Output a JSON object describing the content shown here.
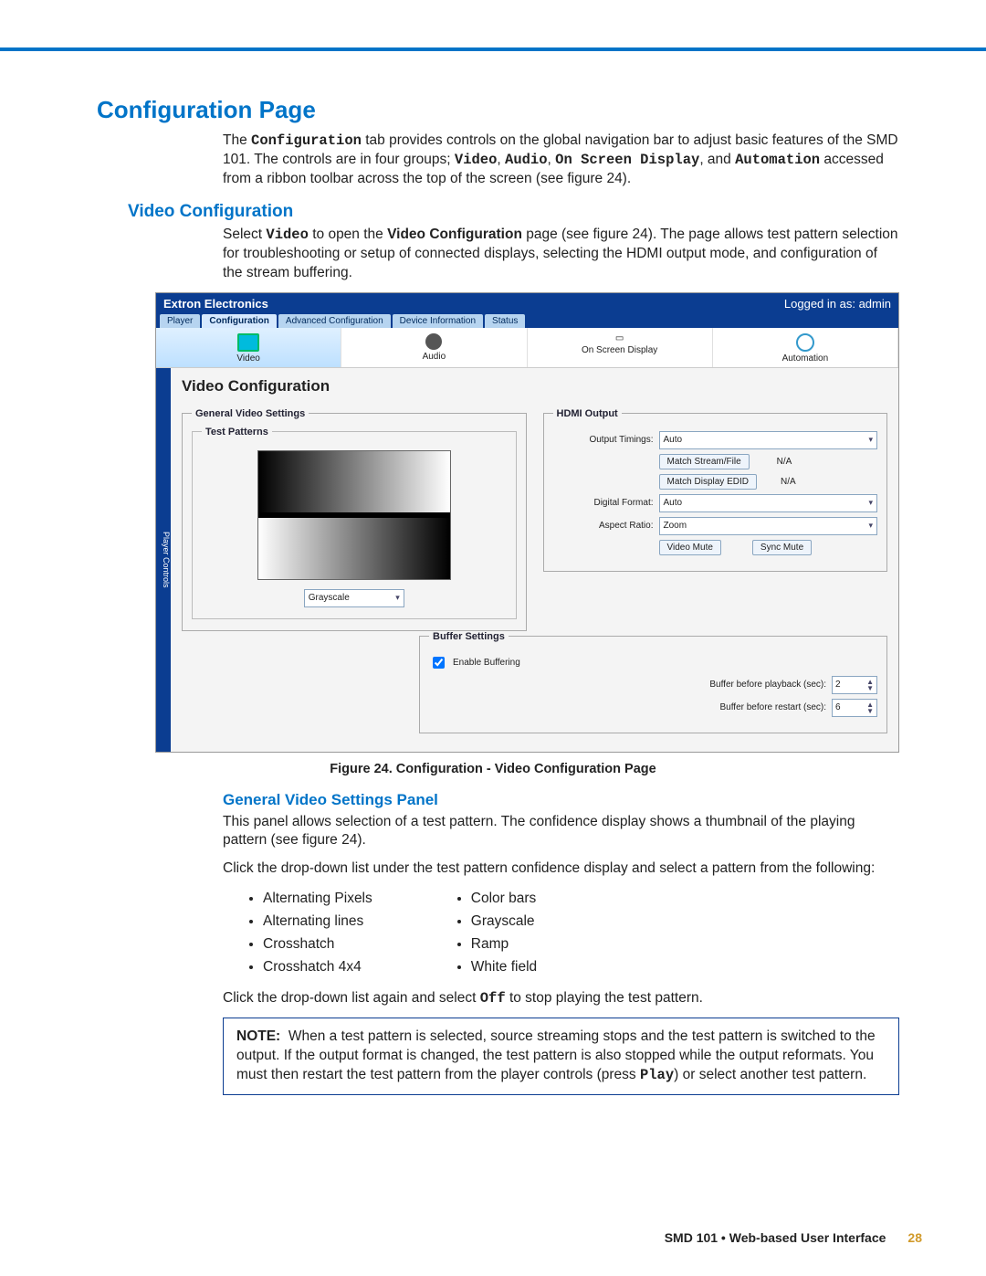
{
  "headings": {
    "h1": "Configuration Page",
    "h2": "Video Configuration",
    "h3": "General Video Settings Panel"
  },
  "intro": {
    "pre1": "The ",
    "m1": "Configuration",
    "mid1": " tab provides controls on the global navigation bar to adjust basic features of the SMD 101. The controls are in four groups; ",
    "m2": "Video",
    "c1": ", ",
    "m3": "Audio",
    "c2": ", ",
    "m4": "On Screen Display",
    "mid2": ", and ",
    "m5": "Automation",
    "post": " accessed from a ribbon toolbar across the top of the screen (see figure 24)."
  },
  "videointro": {
    "pre": "Select ",
    "m1": "Video",
    "mid1": " to open the ",
    "b1": "Video Configuration",
    "post": " page (see figure 24). The page allows test pattern selection for troubleshooting or setup of connected displays, selecting the HDMI output mode, and configuration of the stream buffering."
  },
  "screenshot": {
    "brand": "Extron Electronics",
    "login": "Logged in as: admin",
    "tabs": [
      "Player",
      "Configuration",
      "Advanced Configuration",
      "Device Information",
      "Status"
    ],
    "active_tab": 1,
    "ribbon": [
      "Video",
      "Audio",
      "On Screen Display",
      "Automation"
    ],
    "active_ribbon": 0,
    "sidebar": "Player Controls",
    "main_title": "Video Configuration",
    "general_legend": "General Video Settings",
    "test_legend": "Test Patterns",
    "pattern_value": "Grayscale",
    "hdmi_legend": "HDMI Output",
    "hdmi": {
      "timings_lbl": "Output Timings:",
      "timings_val": "Auto",
      "match_stream_btn": "Match Stream/File",
      "match_stream_val": "N/A",
      "match_edid_btn": "Match Display EDID",
      "match_edid_val": "N/A",
      "digital_lbl": "Digital Format:",
      "digital_val": "Auto",
      "aspect_lbl": "Aspect Ratio:",
      "aspect_val": "Zoom",
      "videomute_btn": "Video Mute",
      "syncmute_btn": "Sync Mute"
    },
    "buffer_legend": "Buffer Settings",
    "buffer": {
      "enable_lbl": "Enable Buffering",
      "before_play_lbl": "Buffer before playback (sec):",
      "before_play_val": "2",
      "before_restart_lbl": "Buffer before restart (sec):",
      "before_restart_val": "6"
    }
  },
  "figcaption": "Figure 24.   Configuration - Video Configuration Page",
  "general_panel_p1": "This panel allows selection of a test pattern. The confidence display shows a thumbnail of the playing pattern (see figure 24).",
  "general_panel_p2": "Click the drop-down list under the test pattern confidence display and select a pattern from the following:",
  "patterns_left": [
    "Alternating Pixels",
    "Alternating lines",
    "Crosshatch",
    "Crosshatch 4x4"
  ],
  "patterns_right": [
    "Color bars",
    "Grayscale",
    "Ramp",
    "White field"
  ],
  "off_line": {
    "pre": "Click the drop-down list again and select ",
    "m": "Off",
    "post": " to stop playing the test pattern."
  },
  "note": {
    "lead": "NOTE:",
    "body_pre": "When a test pattern is selected, source streaming stops and the test pattern is switched to the output. If the output format is changed, the test pattern is also stopped while the output reformats. You must then restart the test pattern from the player controls (press ",
    "m": "Play",
    "body_post": ") or select another test pattern."
  },
  "footer": {
    "text": "SMD 101 • Web-based User Interface",
    "page": "28"
  }
}
